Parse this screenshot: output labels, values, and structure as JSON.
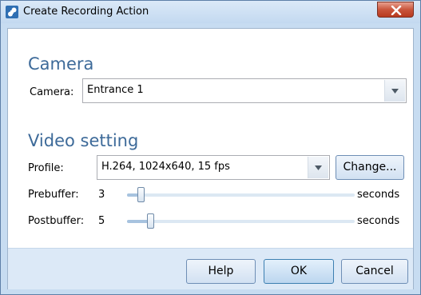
{
  "window": {
    "title": "Create Recording Action",
    "close_icon": "close-icon"
  },
  "camera_section": {
    "heading": "Camera",
    "camera_label": "Camera:",
    "camera_value": "Entrance 1"
  },
  "video_section": {
    "heading": "Video setting",
    "profile_label": "Profile:",
    "profile_value": "H.264, 1024x640, 15 fps",
    "change_button": "Change...",
    "prebuffer": {
      "label": "Prebuffer:",
      "value": "3",
      "unit": "seconds",
      "level": 0.06
    },
    "postbuffer": {
      "label": "Postbuffer:",
      "value": "5",
      "unit": "seconds",
      "level": 0.1
    }
  },
  "buttons": {
    "help": "Help",
    "ok": "OK",
    "cancel": "Cancel"
  }
}
